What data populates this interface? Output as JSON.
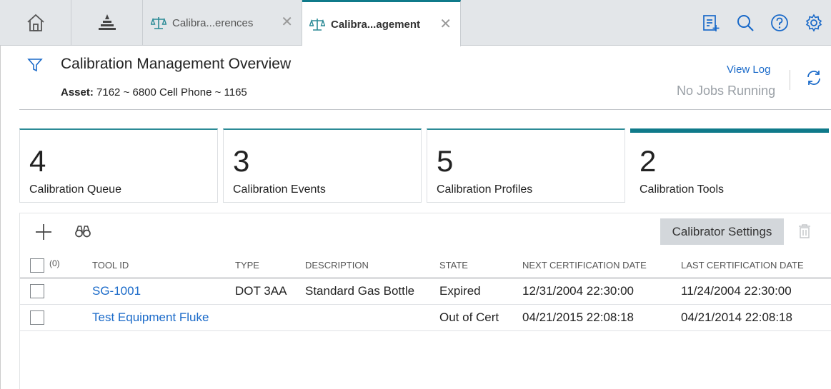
{
  "tabs": [
    {
      "label": "Calibra...erences"
    },
    {
      "label": "Calibra...agement"
    }
  ],
  "header": {
    "title": "Calibration Management Overview",
    "asset_label": "Asset:",
    "asset_value": "7162 ~ 6800 Cell Phone ~ 1165",
    "view_log": "View Log",
    "jobs_status": "No Jobs Running"
  },
  "cards": [
    {
      "count": "4",
      "label": "Calibration Queue"
    },
    {
      "count": "3",
      "label": "Calibration Events"
    },
    {
      "count": "5",
      "label": "Calibration Profiles"
    },
    {
      "count": "2",
      "label": "Calibration Tools"
    }
  ],
  "toolbar": {
    "calibrator_settings": "Calibrator Settings"
  },
  "table": {
    "selected_count": "(0)",
    "columns": [
      "TOOL ID",
      "TYPE",
      "DESCRIPTION",
      "STATE",
      "NEXT CERTIFICATION DATE",
      "LAST CERTIFICATION DATE"
    ],
    "rows": [
      {
        "tool_id": "SG-1001",
        "type": "DOT 3AA",
        "description": "Standard Gas Bottle",
        "state": "Expired",
        "next_cert": "12/31/2004 22:30:00",
        "last_cert": "11/24/2004 22:30:00"
      },
      {
        "tool_id": "Test Equipment Fluke",
        "type": "",
        "description": "",
        "state": "Out of Cert",
        "next_cert": "04/21/2015 22:08:18",
        "last_cert": "04/21/2014 22:08:18"
      }
    ]
  },
  "colors": {
    "accent": "#0f7a8a",
    "link": "#1a6ac9",
    "topbar": "#e3e6e9"
  },
  "icons": [
    "home-icon",
    "pyramid-icon",
    "scales-icon",
    "close-icon",
    "checklist-add-icon",
    "search-icon",
    "help-icon",
    "gear-icon",
    "filter-icon",
    "refresh-icon",
    "plus-icon",
    "binoculars-icon",
    "trash-icon"
  ]
}
